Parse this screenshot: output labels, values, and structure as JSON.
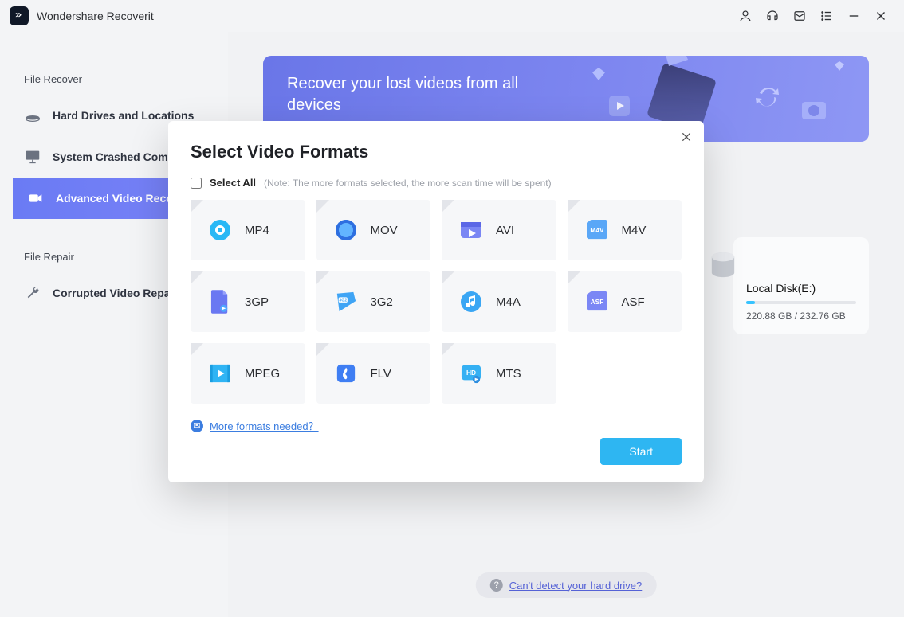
{
  "app": {
    "title": "Wondershare Recoverit"
  },
  "sidebar": {
    "sections": [
      {
        "title": "File Recover",
        "items": [
          {
            "label": "Hard Drives and Locations"
          },
          {
            "label": "System Crashed Computer"
          },
          {
            "label": "Advanced Video Recovery"
          }
        ]
      },
      {
        "title": "File Repair",
        "items": [
          {
            "label": "Corrupted Video Repair"
          }
        ]
      }
    ]
  },
  "hero": {
    "title": "Recover your lost videos from all devices"
  },
  "disk": {
    "name": "Local Disk(E:)",
    "used": "220.88 GB",
    "total": "232.76 GB"
  },
  "hint": {
    "text": "Can't detect your hard drive?"
  },
  "modal": {
    "title": "Select Video Formats",
    "select_all_label": "Select All",
    "select_all_note": "(Note: The more formats selected, the more scan time will be spent)",
    "more_label": "More formats needed？",
    "start_label": "Start",
    "formats": [
      {
        "label": "MP4",
        "icon": "mp4"
      },
      {
        "label": "MOV",
        "icon": "mov"
      },
      {
        "label": "AVI",
        "icon": "avi"
      },
      {
        "label": "M4V",
        "icon": "m4v"
      },
      {
        "label": "3GP",
        "icon": "3gp"
      },
      {
        "label": "3G2",
        "icon": "3g2"
      },
      {
        "label": "M4A",
        "icon": "m4a"
      },
      {
        "label": "ASF",
        "icon": "asf"
      },
      {
        "label": "MPEG",
        "icon": "mpeg"
      },
      {
        "label": "FLV",
        "icon": "flv"
      },
      {
        "label": "MTS",
        "icon": "mts"
      }
    ]
  }
}
